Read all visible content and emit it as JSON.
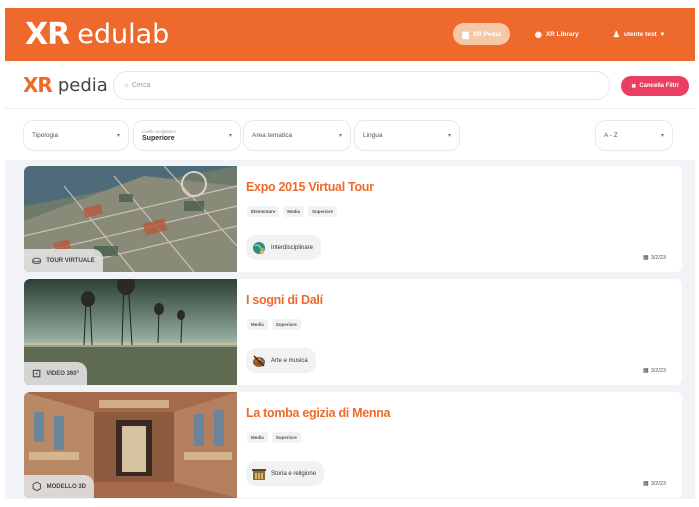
{
  "header": {
    "logo_mark": "XR",
    "logo_name": "edulab",
    "nav": [
      {
        "label": "XR Pedia",
        "icon": "book-icon",
        "glyph": "▆",
        "active": true
      },
      {
        "label": "XR Library",
        "icon": "globe-icon",
        "glyph": "◉",
        "active": false
      },
      {
        "label": "utente test",
        "icon": "user-icon",
        "glyph": "♟",
        "active": false
      }
    ],
    "user_chevron": "▾"
  },
  "search": {
    "logo_mark": "XR",
    "logo_name": "pedia",
    "placeholder": "Cerca",
    "search_glyph": "○",
    "clear_label": "Cancella Filtri",
    "clear_glyph": "✖"
  },
  "filters": [
    {
      "label": "Tipologia",
      "small_label": "",
      "value": ""
    },
    {
      "label": "",
      "small_label": "Livello scolastico",
      "value": "Superiore"
    },
    {
      "label": "Area tematica",
      "small_label": "",
      "value": ""
    },
    {
      "label": "Lingua",
      "small_label": "",
      "value": ""
    },
    {
      "label": "A - Z",
      "small_label": "",
      "value": ""
    }
  ],
  "chevron_glyph": "▾",
  "cards": [
    {
      "title": "Expo 2015 Virtual Tour",
      "tags": [
        "Elementare",
        "Media",
        "Superiore"
      ],
      "subject": "Interdisciplinare",
      "subject_icon": "globe-subject-icon",
      "type": "TOUR VIRTUALE",
      "type_icon": "vr-headset-icon",
      "type_glyph": "⛀",
      "date": "3/2/23",
      "date_glyph": "▦"
    },
    {
      "title": "I sogni di Dalí",
      "tags": [
        "Media",
        "Superiore"
      ],
      "subject": "Arte e musica",
      "subject_icon": "art-palette-icon",
      "type": "VIDEO 360°",
      "type_icon": "video-360-icon",
      "type_glyph": "⊡",
      "date": "3/2/23",
      "date_glyph": "▦"
    },
    {
      "title": "La tomba egizia di Menna",
      "tags": [
        "Media",
        "Superiore"
      ],
      "subject": "Storia e religione",
      "subject_icon": "temple-icon",
      "type": "MODELLO 3D",
      "type_icon": "cube-3d-icon",
      "type_glyph": "⬡",
      "date": "3/2/23",
      "date_glyph": "▦"
    }
  ],
  "colors": {
    "brand_orange": "#ee6a2c",
    "clear_button_pink": "#ea3f63",
    "list_background": "#f2f3f6"
  }
}
